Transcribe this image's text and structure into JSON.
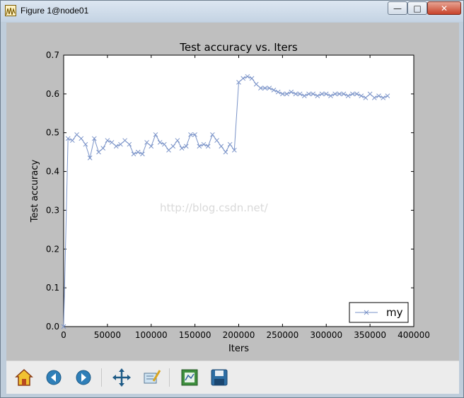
{
  "window": {
    "title": "Figure 1@node01",
    "icon": "matplotlib-figure-icon",
    "buttons": {
      "minimize": "—",
      "maximize": "□",
      "close": "✕"
    }
  },
  "toolbar": {
    "buttons": [
      "home-icon",
      "back-arrow-icon",
      "forward-arrow-icon",
      "pan-icon",
      "zoom-icon",
      "subplots-config-icon",
      "save-icon"
    ]
  },
  "watermark": "http://blog.csdn.net/",
  "chart_data": {
    "type": "line",
    "title": "Test accuracy  vs. Iters",
    "xlabel": "Iters",
    "ylabel": "Test accuracy",
    "xlim": [
      0,
      400000
    ],
    "ylim": [
      0,
      0.7
    ],
    "xticks": [
      "0",
      "50000",
      "100000",
      "150000",
      "200000",
      "250000",
      "300000",
      "350000",
      "400000"
    ],
    "yticks": [
      "0.0",
      "0.1",
      "0.2",
      "0.3",
      "0.4",
      "0.5",
      "0.6",
      "0.7"
    ],
    "grid": false,
    "legend": {
      "position": "bottom-right",
      "entries": [
        "my"
      ]
    },
    "color": "#7a93c8",
    "marker": "x",
    "series": [
      {
        "name": "my",
        "x": [
          0,
          5000,
          10000,
          15000,
          20000,
          25000,
          30000,
          35000,
          40000,
          45000,
          50000,
          55000,
          60000,
          65000,
          70000,
          75000,
          80000,
          85000,
          90000,
          95000,
          100000,
          105000,
          110000,
          115000,
          120000,
          125000,
          130000,
          135000,
          140000,
          145000,
          150000,
          155000,
          160000,
          165000,
          170000,
          175000,
          180000,
          185000,
          190000,
          195000,
          200000,
          205000,
          210000,
          215000,
          220000,
          225000,
          230000,
          235000,
          240000,
          245000,
          250000,
          255000,
          260000,
          265000,
          270000,
          275000,
          280000,
          285000,
          290000,
          295000,
          300000,
          305000,
          310000,
          315000,
          320000,
          325000,
          330000,
          335000,
          340000,
          345000,
          350000,
          355000,
          360000,
          365000,
          370000
        ],
        "y": [
          0.0,
          0.485,
          0.48,
          0.495,
          0.485,
          0.47,
          0.435,
          0.485,
          0.45,
          0.46,
          0.48,
          0.475,
          0.465,
          0.47,
          0.48,
          0.47,
          0.445,
          0.45,
          0.445,
          0.475,
          0.465,
          0.495,
          0.475,
          0.47,
          0.455,
          0.465,
          0.48,
          0.46,
          0.465,
          0.495,
          0.495,
          0.465,
          0.47,
          0.465,
          0.495,
          0.48,
          0.465,
          0.45,
          0.47,
          0.455,
          0.63,
          0.64,
          0.645,
          0.64,
          0.625,
          0.615,
          0.615,
          0.615,
          0.61,
          0.605,
          0.6,
          0.6,
          0.605,
          0.6,
          0.6,
          0.595,
          0.6,
          0.6,
          0.595,
          0.6,
          0.6,
          0.595,
          0.6,
          0.6,
          0.6,
          0.595,
          0.6,
          0.6,
          0.595,
          0.59,
          0.6,
          0.59,
          0.595,
          0.59,
          0.595
        ]
      }
    ]
  }
}
